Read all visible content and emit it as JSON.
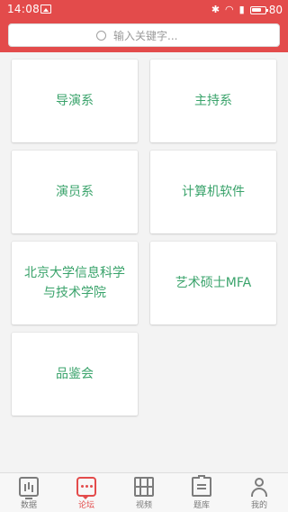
{
  "status_bar": {
    "time": "14:08",
    "battery_pct": "80",
    "battery_level": 0.8,
    "signal_label": "4G"
  },
  "search": {
    "placeholder": "输入关键字..."
  },
  "cards": [
    {
      "label": "导演系"
    },
    {
      "label": "主持系"
    },
    {
      "label": "演员系"
    },
    {
      "label": "计算机软件"
    },
    {
      "label": "北京大学信息科学与技术学院"
    },
    {
      "label": "艺术硕士MFA"
    },
    {
      "label": "品鉴会"
    }
  ],
  "bottom_nav": {
    "items": [
      {
        "label": "数据",
        "icon": "chart-icon"
      },
      {
        "label": "论坛",
        "icon": "chat-bubble-icon",
        "active": true
      },
      {
        "label": "视频",
        "icon": "film-icon"
      },
      {
        "label": "题库",
        "icon": "clipboard-icon"
      },
      {
        "label": "我的",
        "icon": "person-icon"
      }
    ]
  },
  "colors": {
    "brand_red": "#e34b4b",
    "card_text_green": "#3aa36b",
    "background": "#f3f3f3"
  }
}
